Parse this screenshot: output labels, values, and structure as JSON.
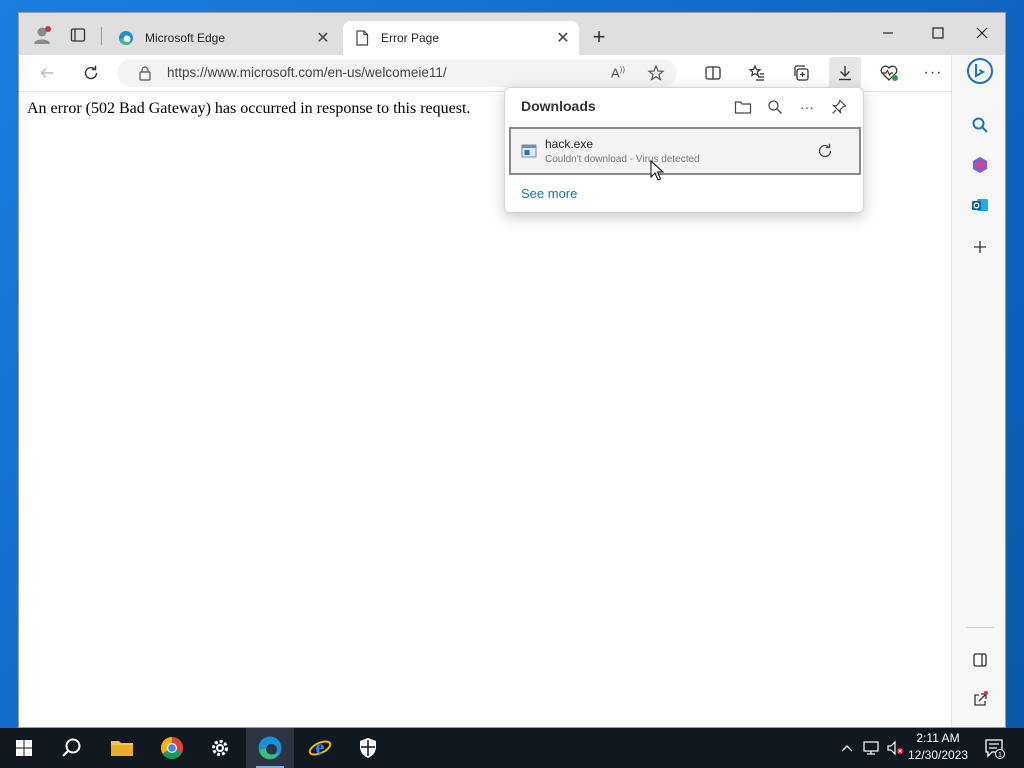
{
  "browser": {
    "tabs": [
      {
        "title": "Microsoft Edge"
      },
      {
        "title": "Error Page"
      }
    ],
    "address": {
      "url": "https://www.microsoft.com/en-us/welcomeie11/"
    }
  },
  "page": {
    "error_text": "An error (502 Bad Gateway) has occurred in response to this request."
  },
  "downloads": {
    "title": "Downloads",
    "items": [
      {
        "name": "hack.exe",
        "status": "Couldn't download - Virus detected"
      }
    ],
    "see_more": "See more"
  },
  "taskbar": {
    "time": "2:11 AM",
    "date": "12/30/2023",
    "notification_count": "1"
  },
  "colors": {
    "accent": "#0f6cbd",
    "link": "#1a6fb0",
    "taskbar": "#101820"
  }
}
